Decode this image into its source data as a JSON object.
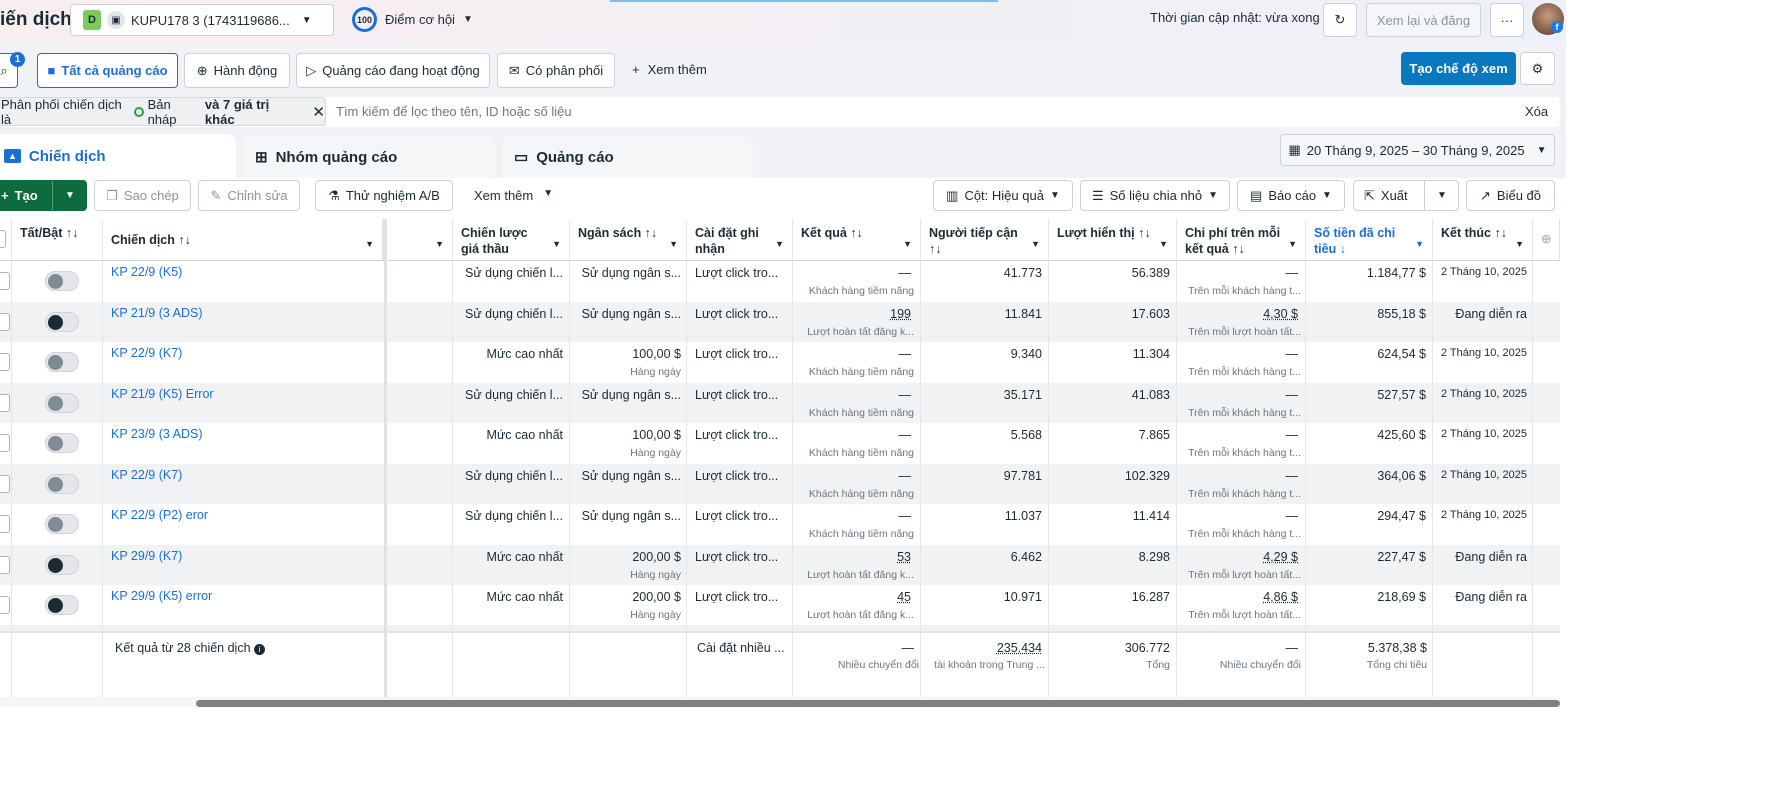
{
  "header": {
    "title": "iến dịch",
    "account_initial": "D",
    "account_name": "KUPU178 3 (1743119686...",
    "score": "100",
    "score_label": "Điểm cơ hội",
    "update_text": "Thời gian cập nhật: vừa xong",
    "review_button": "Xem lại và đăng",
    "more": "···"
  },
  "filters": {
    "search_badge": "1",
    "chips": [
      "Tất cả quảng cáo",
      "Hành động",
      "Quảng cáo đang hoạt động",
      "Có phân phối"
    ],
    "see_more": "Xem thêm",
    "create_view": "Tạo chế độ xem",
    "filter_prefix": "Phân phối chiến dịch là",
    "filter_value": "Bản nháp",
    "filter_more": "và 7 giá trị khác",
    "search_placeholder": "Tìm kiếm để lọc theo tên, ID hoặc số liệu",
    "clear": "Xóa"
  },
  "tabs": [
    "Chiến dịch",
    "Nhóm quảng cáo",
    "Quảng cáo"
  ],
  "date_range": "20 Tháng 9, 2025 – 30 Tháng 9, 2025",
  "toolbar": {
    "create": "Tạo",
    "copy": "Sao chép",
    "edit": "Chỉnh sửa",
    "ab_test": "Thử nghiệm A/B",
    "more": "Xem thêm",
    "columns": "Cột: Hiệu quả",
    "breakdown": "Số liệu chia nhỏ",
    "reports": "Báo cáo",
    "export": "Xuất",
    "charts": "Biểu đồ"
  },
  "columns": [
    "Tất/Bật ↑↓",
    "Chiến dịch ↑↓",
    "",
    "Chiến lược giá thầu",
    "Ngân sách ↑↓",
    "Cài đặt ghi nhận",
    "Kết quả ↑↓",
    "Người tiếp cận ↑↓",
    "Lượt hiển thị ↑↓",
    "Chi phí trên mỗi kết quả ↑↓",
    "Số tiền đã chi tiêu ↓",
    "Kết thúc ↑↓"
  ],
  "accent_color": "#1a6ed8",
  "rows": [
    {
      "on": false,
      "name": "KP 22/9 (K5)",
      "bid": "Sử dụng chiến l...",
      "budget": "Sử dụng ngân s...",
      "budget_sub": "",
      "attr": "Lượt click tro...",
      "result": "—",
      "result_sub": "Khách hàng tiềm năng",
      "reach": "41.773",
      "impr": "56.389",
      "cpr": "—",
      "cpr_sub": "Trên mỗi khách hàng t...",
      "spent": "1.184,77 $",
      "end": "2 Tháng 10, 2025"
    },
    {
      "on": true,
      "name": "KP 21/9 (3 ADS)",
      "bid": "Sử dụng chiến l...",
      "budget": "Sử dụng ngân s...",
      "budget_sub": "",
      "attr": "Lượt click tro...",
      "result": "199",
      "result_sub": "Lượt hoàn tất đăng k...",
      "reach": "11.841",
      "impr": "17.603",
      "cpr": "4,30 $",
      "cpr_sub": "Trên mỗi lượt hoàn tất...",
      "spent": "855,18 $",
      "end": "Đang diễn ra"
    },
    {
      "on": false,
      "name": "KP 22/9 (K7)",
      "bid": "Mức cao nhất",
      "budget": "100,00 $",
      "budget_sub": "Hàng ngày",
      "attr": "Lượt click tro...",
      "result": "—",
      "result_sub": "Khách hàng tiềm năng",
      "reach": "9.340",
      "impr": "11.304",
      "cpr": "—",
      "cpr_sub": "Trên mỗi khách hàng t...",
      "spent": "624,54 $",
      "end": "2 Tháng 10, 2025"
    },
    {
      "on": false,
      "name": "KP 21/9 (K5) Error",
      "bid": "Sử dụng chiến l...",
      "budget": "Sử dụng ngân s...",
      "budget_sub": "",
      "attr": "Lượt click tro...",
      "result": "—",
      "result_sub": "Khách hàng tiềm năng",
      "reach": "35.171",
      "impr": "41.083",
      "cpr": "—",
      "cpr_sub": "Trên mỗi khách hàng t...",
      "spent": "527,57 $",
      "end": "2 Tháng 10, 2025"
    },
    {
      "on": false,
      "name": "KP 23/9 (3 ADS)",
      "bid": "Mức cao nhất",
      "budget": "100,00 $",
      "budget_sub": "Hàng ngày",
      "attr": "Lượt click tro...",
      "result": "—",
      "result_sub": "Khách hàng tiềm năng",
      "reach": "5.568",
      "impr": "7.865",
      "cpr": "—",
      "cpr_sub": "Trên mỗi khách hàng t...",
      "spent": "425,60 $",
      "end": "2 Tháng 10, 2025"
    },
    {
      "on": false,
      "name": "KP 22/9 (K7)",
      "bid": "Sử dụng chiến l...",
      "budget": "Sử dụng ngân s...",
      "budget_sub": "",
      "attr": "Lượt click tro...",
      "result": "—",
      "result_sub": "Khách hàng tiềm năng",
      "reach": "97.781",
      "impr": "102.329",
      "cpr": "—",
      "cpr_sub": "Trên mỗi khách hàng t...",
      "spent": "364,06 $",
      "end": "2 Tháng 10, 2025"
    },
    {
      "on": false,
      "name": "KP 22/9 (P2) eror",
      "bid": "Sử dụng chiến l...",
      "budget": "Sử dụng ngân s...",
      "budget_sub": "",
      "attr": "Lượt click tro...",
      "result": "—",
      "result_sub": "Khách hàng tiềm năng",
      "reach": "11.037",
      "impr": "11.414",
      "cpr": "—",
      "cpr_sub": "Trên mỗi khách hàng t...",
      "spent": "294,47 $",
      "end": "2 Tháng 10, 2025"
    },
    {
      "on": true,
      "name": "KP 29/9 (K7)",
      "bid": "Mức cao nhất",
      "budget": "200,00 $",
      "budget_sub": "Hàng ngày",
      "attr": "Lượt click tro...",
      "result": "53",
      "result_sub": "Lượt hoàn tất đăng k...",
      "reach": "6.462",
      "impr": "8.298",
      "cpr": "4,29 $",
      "cpr_sub": "Trên mỗi lượt hoàn tất...",
      "spent": "227,47 $",
      "end": "Đang diễn ra"
    },
    {
      "on": true,
      "name": "KP 29/9 (K5) error",
      "bid": "Mức cao nhất",
      "budget": "200,00 $",
      "budget_sub": "Hàng ngày",
      "attr": "Lượt click tro...",
      "result": "45",
      "result_sub": "Lượt hoàn tất đăng k...",
      "reach": "10.971",
      "impr": "16.287",
      "cpr": "4,86 $",
      "cpr_sub": "Trên mỗi lượt hoàn tất...",
      "spent": "218,69 $",
      "end": "Đang diễn ra"
    }
  ],
  "footer": {
    "label": "Kết quả từ 28 chiến dịch",
    "attr": "Cài đặt nhiều ...",
    "result": "—",
    "result_sub": "Nhiều chuyển đổi",
    "reach": "235.434",
    "reach_sub": "tài khoản trong Trung ...",
    "impr": "306.772",
    "impr_sub": "Tổng",
    "cpr": "—",
    "cpr_sub": "Nhiều chuyển đổi",
    "spent": "5.378,38 $",
    "spent_sub": "Tổng chi tiêu"
  }
}
